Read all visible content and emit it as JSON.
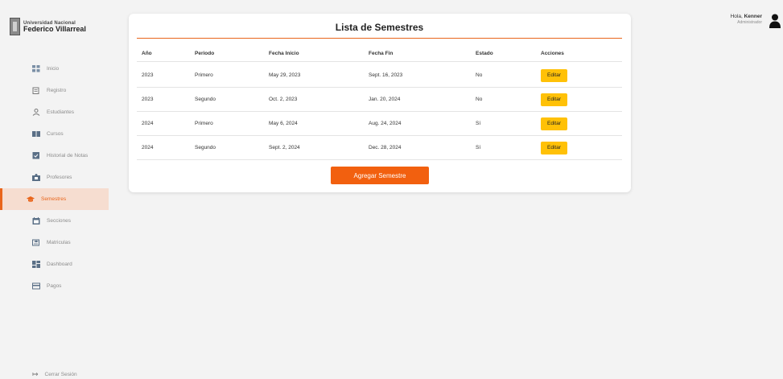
{
  "sidebar": {
    "logo": {
      "line1": "Universidad Nacional",
      "line2": "Federico Villarreal"
    },
    "items": [
      {
        "label": "Inicio",
        "icon": "grid-icon"
      },
      {
        "label": "Registro",
        "icon": "clipboard-icon"
      },
      {
        "label": "Estudiantes",
        "icon": "user-icon"
      },
      {
        "label": "Cursos",
        "icon": "book-icon"
      },
      {
        "label": "Historial de Notas",
        "icon": "checkbox-icon"
      },
      {
        "label": "Profesores",
        "icon": "teacher-icon"
      },
      {
        "label": "Semestres",
        "icon": "graduation-cap-icon",
        "active": true
      },
      {
        "label": "Secciones",
        "icon": "calendar-icon"
      },
      {
        "label": "Matriculas",
        "icon": "enroll-icon"
      },
      {
        "label": "Dashboard",
        "icon": "dashboard-icon"
      },
      {
        "label": "Pagos",
        "icon": "card-icon"
      }
    ],
    "logout_label": "Cerrar Sesión"
  },
  "user": {
    "greeting": "Hola,",
    "name": "Kenner",
    "role": "Administrador"
  },
  "main": {
    "title": "Lista de Semestres",
    "columns": [
      "Año",
      "Periodo",
      "Fecha Inicio",
      "Fecha Fin",
      "Estado",
      "Acciones"
    ],
    "rows": [
      {
        "year": "2023",
        "period": "Primero",
        "start": "May 29, 2023",
        "end": "Sept. 16, 2023",
        "status": "No",
        "action": "Editar"
      },
      {
        "year": "2023",
        "period": "Segundo",
        "start": "Oct. 2, 2023",
        "end": "Jan. 20, 2024",
        "status": "No",
        "action": "Editar"
      },
      {
        "year": "2024",
        "period": "Primero",
        "start": "May 6, 2024",
        "end": "Aug. 24, 2024",
        "status": "Sí",
        "action": "Editar"
      },
      {
        "year": "2024",
        "period": "Segundo",
        "start": "Sept. 2, 2024",
        "end": "Dec. 28, 2024",
        "status": "Sí",
        "action": "Editar"
      }
    ],
    "add_button": "Agregar Semestre"
  },
  "colors": {
    "accent": "#f2600f",
    "edit_button": "#ffc107",
    "active_bg": "#f6ddd0"
  }
}
